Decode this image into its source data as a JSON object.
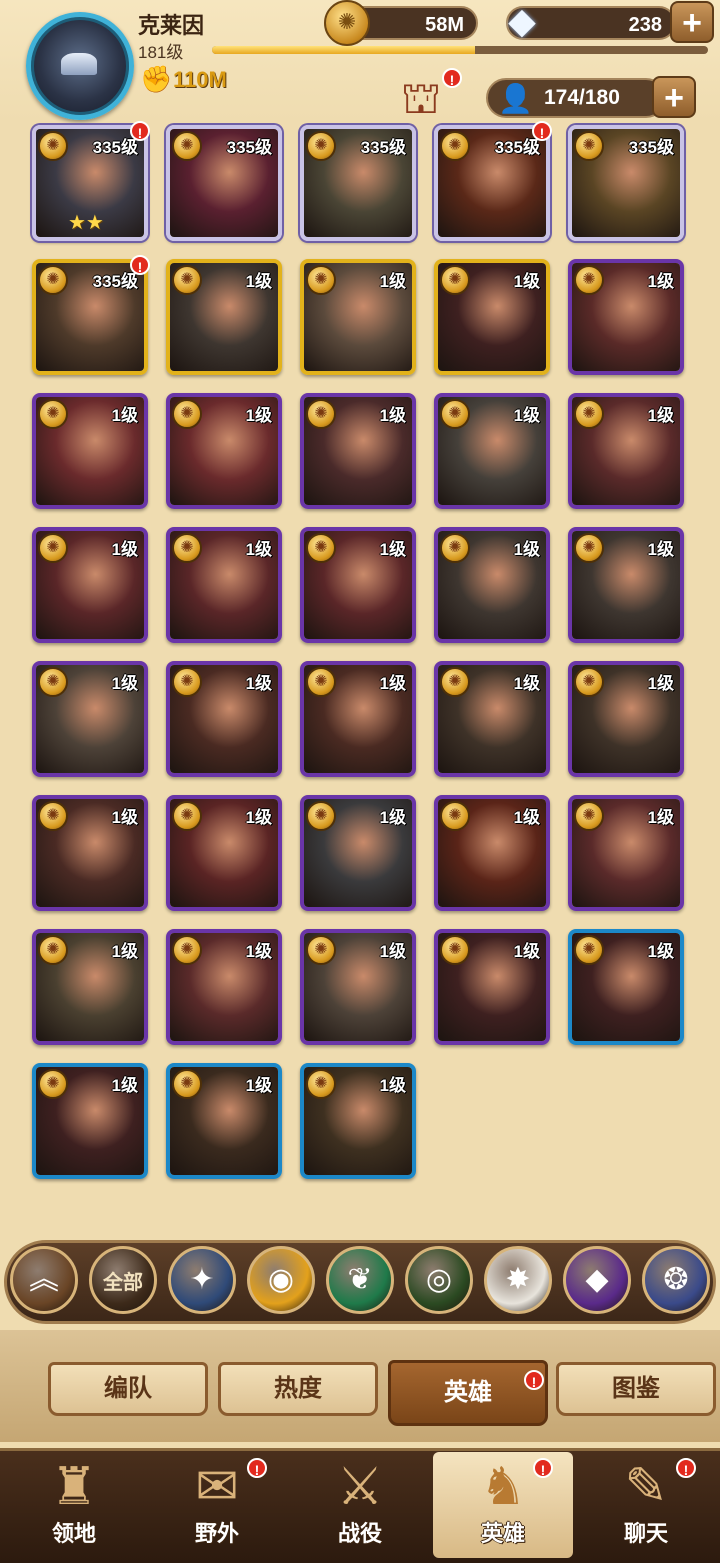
{
  "player": {
    "name": "克莱因",
    "level": "181级",
    "power": "110M",
    "xp_fraction": 0.53
  },
  "resources": {
    "gold": "58M",
    "gems": "238"
  },
  "hero_count": "174/180",
  "heroes": [
    {
      "level": "335级",
      "frame": "silver",
      "alert": true,
      "stars": "★★",
      "bg": "#3b3a45"
    },
    {
      "level": "335级",
      "frame": "silver",
      "alert": false,
      "stars": "",
      "bg": "#5a2030"
    },
    {
      "level": "335级",
      "frame": "silver",
      "alert": false,
      "stars": "",
      "bg": "#4a4535"
    },
    {
      "level": "335级",
      "frame": "silver",
      "alert": true,
      "stars": "",
      "bg": "#5a2818"
    },
    {
      "level": "335级",
      "frame": "silver",
      "alert": false,
      "stars": "",
      "bg": "#5a4524"
    },
    {
      "level": "335级",
      "frame": "legend",
      "alert": true,
      "stars": "",
      "bg": "#4e3a2a"
    },
    {
      "level": "1级",
      "frame": "legend",
      "alert": false,
      "stars": "",
      "bg": "#3e3630"
    },
    {
      "level": "1级",
      "frame": "legend",
      "alert": false,
      "stars": "",
      "bg": "#5b4a3c"
    },
    {
      "level": "1级",
      "frame": "legend",
      "alert": false,
      "stars": "",
      "bg": "#3e2020"
    },
    {
      "level": "1级",
      "frame": "epic",
      "alert": false,
      "stars": "",
      "bg": "#5a2a28"
    },
    {
      "level": "1级",
      "frame": "epic",
      "alert": false,
      "stars": "",
      "bg": "#6a2a2c"
    },
    {
      "level": "1级",
      "frame": "epic",
      "alert": false,
      "stars": "",
      "bg": "#6a2a2c"
    },
    {
      "level": "1级",
      "frame": "epic",
      "alert": false,
      "stars": "",
      "bg": "#4a2a2a"
    },
    {
      "level": "1级",
      "frame": "epic",
      "alert": false,
      "stars": "",
      "bg": "#45403a"
    },
    {
      "level": "1级",
      "frame": "epic",
      "alert": false,
      "stars": "",
      "bg": "#5a2a2a"
    },
    {
      "level": "1级",
      "frame": "epic",
      "alert": false,
      "stars": "",
      "bg": "#5a2628"
    },
    {
      "level": "1级",
      "frame": "epic",
      "alert": false,
      "stars": "",
      "bg": "#5a2628"
    },
    {
      "level": "1级",
      "frame": "epic",
      "alert": false,
      "stars": "",
      "bg": "#5a2628"
    },
    {
      "level": "1级",
      "frame": "epic",
      "alert": false,
      "stars": "",
      "bg": "#3e3630"
    },
    {
      "level": "1级",
      "frame": "epic",
      "alert": false,
      "stars": "",
      "bg": "#3e3630"
    },
    {
      "level": "1级",
      "frame": "epic",
      "alert": false,
      "stars": "",
      "bg": "#4d4238"
    },
    {
      "level": "1级",
      "frame": "epic",
      "alert": false,
      "stars": "",
      "bg": "#4a2a22"
    },
    {
      "level": "1级",
      "frame": "epic",
      "alert": false,
      "stars": "",
      "bg": "#4a2a22"
    },
    {
      "level": "1级",
      "frame": "epic",
      "alert": false,
      "stars": "",
      "bg": "#3e3228"
    },
    {
      "level": "1级",
      "frame": "epic",
      "alert": false,
      "stars": "",
      "bg": "#3e3228"
    },
    {
      "level": "1级",
      "frame": "epic",
      "alert": false,
      "stars": "",
      "bg": "#4a2a24"
    },
    {
      "level": "1级",
      "frame": "epic",
      "alert": false,
      "stars": "",
      "bg": "#5a2424"
    },
    {
      "level": "1级",
      "frame": "epic",
      "alert": false,
      "stars": "",
      "bg": "#3a3a3c"
    },
    {
      "level": "1级",
      "frame": "epic",
      "alert": false,
      "stars": "",
      "bg": "#5a2418"
    },
    {
      "level": "1级",
      "frame": "epic",
      "alert": false,
      "stars": "",
      "bg": "#5a2a2a"
    },
    {
      "level": "1级",
      "frame": "epic",
      "alert": false,
      "stars": "",
      "bg": "#4a4030"
    },
    {
      "level": "1级",
      "frame": "epic",
      "alert": false,
      "stars": "",
      "bg": "#5a2a2a"
    },
    {
      "level": "1级",
      "frame": "epic",
      "alert": false,
      "stars": "",
      "bg": "#4d4238"
    },
    {
      "level": "1级",
      "frame": "epic",
      "alert": false,
      "stars": "",
      "bg": "#3e2020"
    },
    {
      "level": "1级",
      "frame": "blue",
      "alert": false,
      "stars": "",
      "bg": "#3e2020"
    },
    {
      "level": "1级",
      "frame": "blue",
      "alert": false,
      "stars": "",
      "bg": "#3e2020"
    },
    {
      "level": "1级",
      "frame": "blue",
      "alert": false,
      "stars": "",
      "bg": "#3a2a1e"
    },
    {
      "level": "1级",
      "frame": "blue",
      "alert": false,
      "stars": "",
      "bg": "#3e3020"
    }
  ],
  "filters": [
    {
      "name": "filter-all-up",
      "icon": "chevrons-up-icon",
      "glyph": "︽",
      "label": "",
      "bg": "#6a4526"
    },
    {
      "name": "filter-all",
      "icon": "all-icon",
      "glyph": "",
      "label": "全部",
      "bg": "#3d2a1a"
    },
    {
      "name": "filter-lightbearer",
      "icon": "compass-star-icon",
      "glyph": "✦",
      "label": "",
      "bg": "#2f4a78"
    },
    {
      "name": "filter-mauler",
      "icon": "gold-shield-icon",
      "glyph": "◉",
      "label": "",
      "bg": "#e3a11c"
    },
    {
      "name": "filter-wilder",
      "icon": "leaf-icon",
      "glyph": "❦",
      "label": "",
      "bg": "#1f7a4a"
    },
    {
      "name": "filter-graveborn",
      "icon": "eye-icon",
      "glyph": "◎",
      "label": "",
      "bg": "#2b4a22"
    },
    {
      "name": "filter-celestial",
      "icon": "white-star-icon",
      "glyph": "✸",
      "label": "",
      "bg": "#e8e4dc"
    },
    {
      "name": "filter-hypogean",
      "icon": "purple-crystal-icon",
      "glyph": "◆",
      "label": "",
      "bg": "#5a2a8a"
    },
    {
      "name": "filter-dimensional",
      "icon": "ring-icon",
      "glyph": "❂",
      "label": "",
      "bg": "#3a4a8a"
    }
  ],
  "subtabs": [
    {
      "label": "编队",
      "active": false
    },
    {
      "label": "热度",
      "active": false
    },
    {
      "label": "英雄",
      "active": true
    },
    {
      "label": "图鉴",
      "active": false
    }
  ],
  "nav": [
    {
      "label": "领地",
      "icon": "castle-icon",
      "glyph": "♜",
      "alert": false,
      "active": false
    },
    {
      "label": "野外",
      "icon": "scroll-map-icon",
      "glyph": "✉",
      "alert": true,
      "active": false
    },
    {
      "label": "战役",
      "icon": "sword-shield-icon",
      "glyph": "⚔",
      "alert": false,
      "active": false
    },
    {
      "label": "英雄",
      "icon": "hero-helmet-icon",
      "glyph": "♞",
      "alert": true,
      "active": true
    },
    {
      "label": "聊天",
      "icon": "chat-bubble-icon",
      "glyph": "✎",
      "alert": true,
      "active": false
    }
  ],
  "colors": {
    "epic": "#6a35a8",
    "legend": "#e2b21b",
    "blue": "#1c88c8",
    "alert": "#e22a1e"
  }
}
